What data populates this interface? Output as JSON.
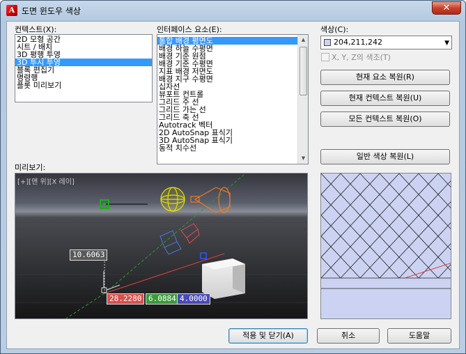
{
  "window": {
    "title": "도면 윈도우 색상",
    "close_label": "✕"
  },
  "context": {
    "label": "컨텍스트(X):",
    "items": [
      "2D 모형 공간",
      "시트 / 배치",
      "3D 평행 투영",
      "3D 투시 투영",
      "블록 편집기",
      "명령행",
      "플롯 미리보기"
    ],
    "selected_index": 3
  },
  "interface": {
    "label": "인터페이스 요소(E):",
    "items": [
      "통합 배경 평면도",
      "배경 하늘 수평면",
      "배경 기준 원점",
      "배경 기준 수평면",
      "지표 배경 저면도",
      "배경 지구 수평면",
      "십자선",
      "뷰포트 컨트롤",
      "그리드 주 선",
      "그리드 가는 선",
      "그리드 축 선",
      "Autotrack 벡터",
      "2D AutoSnap 표식기",
      "3D AutoSnap 표식기",
      "동적 치수선"
    ],
    "selected_index": 0
  },
  "color": {
    "label": "색상(C):",
    "value": "204,211,242",
    "swatch": "#ccd3f2",
    "xyz_label": "X, Y, Z의 색조(T)"
  },
  "buttons": {
    "restore_element": "현재 요소 복원(R)",
    "restore_context": "현재 컨텍스트 복원(U)",
    "restore_all": "모든 컨텍스트 복원(O)",
    "restore_classic": "일반 색상 복원(L)",
    "apply_close": "적용 및 닫기(A)",
    "cancel": "취소",
    "help": "도움말"
  },
  "preview": {
    "label": "미리보기:",
    "viewport_label": "[+][맨 위][X 레이]",
    "dim_value": "10.6063",
    "coord_x": "28.2280",
    "coord_y": "6.0884",
    "coord_z": "4.0000",
    "coord_x_color": "#d9504a",
    "coord_y_color": "#3a9a3a",
    "coord_z_color": "#4a4ab8"
  }
}
